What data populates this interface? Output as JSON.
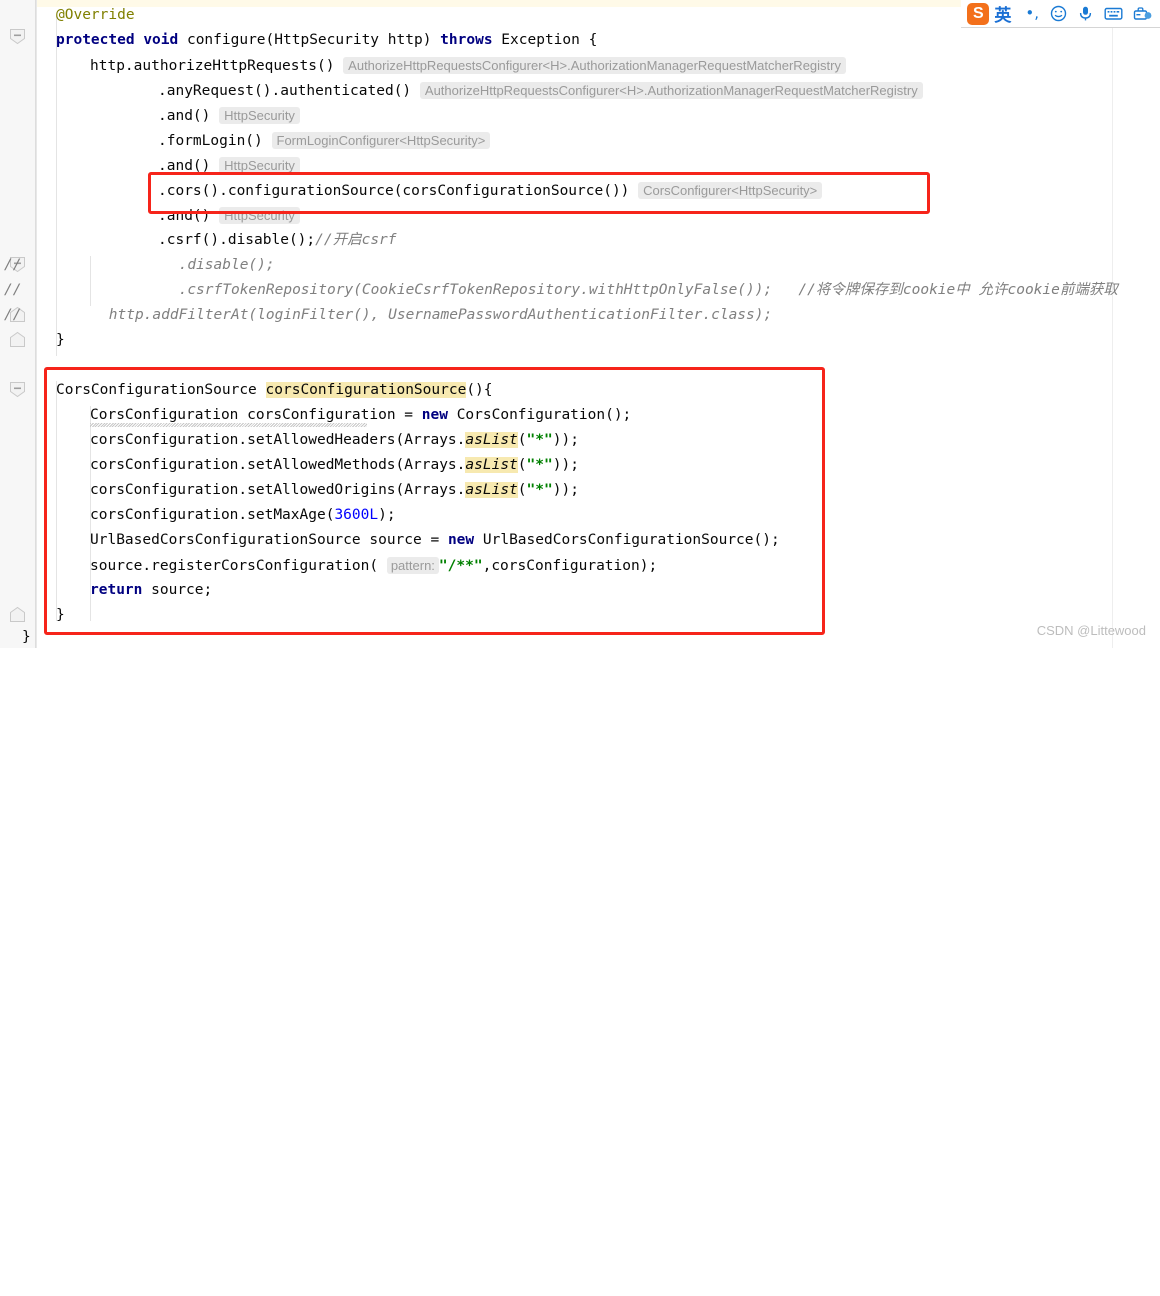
{
  "editor": {
    "caret_line_highlight": "#fffae8",
    "background": "#ffffff",
    "gutter_background": "#f7f7f7",
    "accent_box_color": "#f6241a",
    "identifier_highlight_color": "#f7e9b0",
    "keyword_color": "#000080",
    "string_color": "#008000",
    "comment_color": "#808080",
    "number_color": "#0000ff",
    "inlay_color": "#9a9a9a"
  },
  "code": {
    "lines": [
      {
        "id": "l1",
        "text": "    @Override"
      },
      {
        "id": "l2",
        "text": "    protected void configure(HttpSecurity http) throws Exception {"
      },
      {
        "id": "l3",
        "text": "        http.authorizeHttpRequests()"
      },
      {
        "id": "l3h",
        "text": "AuthorizeHttpRequestsConfigurer<H>.AuthorizationManagerRequestMatcherRegistry"
      },
      {
        "id": "l4",
        "text": "                .anyRequest().authenticated()"
      },
      {
        "id": "l4h",
        "text": "AuthorizeHttpRequestsConfigurer<H>.AuthorizationManagerRequestMatcherRegistry"
      },
      {
        "id": "l5",
        "text": "                .and()"
      },
      {
        "id": "l5h",
        "text": "HttpSecurity"
      },
      {
        "id": "l6",
        "text": "                .formLogin()"
      },
      {
        "id": "l6h",
        "text": "FormLoginConfigurer<HttpSecurity>"
      },
      {
        "id": "l7",
        "text": "                .and()"
      },
      {
        "id": "l7h",
        "text": "HttpSecurity"
      },
      {
        "id": "l8",
        "text": "                .cors().configurationSource(corsConfigurationSource())"
      },
      {
        "id": "l8h",
        "text": "CorsConfigurer<HttpSecurity>"
      },
      {
        "id": "l9",
        "text": "                .and()"
      },
      {
        "id": "l9h",
        "text": "HttpSecurity"
      },
      {
        "id": "l10",
        "text": "                .csrf().disable();"
      },
      {
        "id": "l10c",
        "text": "//开启csrf"
      },
      {
        "id": "l11",
        "text": "//                  .disable();"
      },
      {
        "id": "l12",
        "text": "//                  .csrfTokenRepository(CookieCsrfTokenRepository.withHttpOnlyFalse());   //将令牌保存到cookie中 允许cookie前端获取"
      },
      {
        "id": "l13",
        "text": "//          http.addFilterAt(loginFilter(), UsernamePasswordAuthenticationFilter.class);"
      },
      {
        "id": "l14",
        "text": "    }"
      },
      {
        "id": "l15",
        "text": "    CorsConfigurationSource corsConfigurationSource(){"
      },
      {
        "id": "l16",
        "text": "        CorsConfiguration corsConfiguration = new CorsConfiguration();"
      },
      {
        "id": "l17",
        "text": "        corsConfiguration.setAllowedHeaders(Arrays.asList(\"*\"));"
      },
      {
        "id": "l18",
        "text": "        corsConfiguration.setAllowedMethods(Arrays.asList(\"*\"));"
      },
      {
        "id": "l19",
        "text": "        corsConfiguration.setAllowedOrigins(Arrays.asList(\"*\"));"
      },
      {
        "id": "l20",
        "text": "        corsConfiguration.setMaxAge(3600L);"
      },
      {
        "id": "l21",
        "text": "        UrlBasedCorsConfigurationSource source = new UrlBasedCorsConfigurationSource();"
      },
      {
        "id": "l22",
        "text": "        source.registerCorsConfiguration( \"/**\",corsConfiguration);"
      },
      {
        "id": "l22p",
        "text": "pattern:"
      },
      {
        "id": "l23",
        "text": "        return source;"
      },
      {
        "id": "l24",
        "text": "    }"
      },
      {
        "id": "l25",
        "text": "}"
      }
    ],
    "tokens": {
      "annotation_override": "@Override",
      "kw_protected": "protected",
      "kw_void": "void",
      "kw_throws": "throws",
      "kw_new": "new",
      "kw_return": "return",
      "method_configure": "configure",
      "type_HttpSecurity": "HttpSecurity",
      "param_http": "http",
      "type_Exception": "Exception",
      "call_authorizeHttpRequests": "http.authorizeHttpRequests()",
      "call_anyRequest": ".anyRequest().authenticated()",
      "call_and": ".and()",
      "call_formLogin": ".formLogin()",
      "call_cors": ".cors().configurationSource(corsConfigurationSource())",
      "call_csrf": ".csrf().disable();",
      "comment_csrf": "//开启csrf",
      "comment_disable": "//                  .disable();",
      "comment_tokenrepo": "//                  .csrfTokenRepository(CookieCsrfTokenRepository.withHttpOnlyFalse());",
      "comment_tokenrepo_cn": "//将令牌保存到cookie中 允许cookie前端获取",
      "comment_addfilter": "//          http.addFilterAt(loginFilter(), UsernamePasswordAuthenticationFilter.class);",
      "type_CorsConfigurationSource": "CorsConfigurationSource",
      "method_corsConfigurationSource": "corsConfigurationSource",
      "type_CorsConfiguration": "CorsConfiguration",
      "var_corsConfiguration": "corsConfiguration",
      "static_asList": "asList",
      "class_Arrays": "Arrays",
      "string_star": "\"*\"",
      "number_3600L": "3600L",
      "type_UrlBased": "UrlBasedCorsConfigurationSource",
      "var_source": "source",
      "string_pattern": "\"/**\"",
      "hint_pattern": "pattern:"
    }
  },
  "inlay_hints": [
    {
      "id": "h1",
      "text": "AuthorizeHttpRequestsConfigurer<H>.AuthorizationManagerRequestMatcherRegistry"
    },
    {
      "id": "h2",
      "text": "AuthorizeHttpRequestsConfigurer<H>.AuthorizationManagerRequestMatcherRegistry"
    },
    {
      "id": "h3",
      "text": "HttpSecurity"
    },
    {
      "id": "h4",
      "text": "FormLoginConfigurer<HttpSecurity>"
    },
    {
      "id": "h5",
      "text": "HttpSecurity"
    },
    {
      "id": "h6",
      "text": "CorsConfigurer<HttpSecurity>"
    },
    {
      "id": "h7",
      "text": "HttpSecurity"
    },
    {
      "id": "h8",
      "text": "pattern:"
    }
  ],
  "ime_toolbar": {
    "logo_text": "S",
    "logo_color": "#f3701b",
    "mode_label": "英",
    "icons": [
      {
        "name": "punctuation-icon",
        "glyph": "•,"
      },
      {
        "name": "emoji-icon",
        "glyph": "☺"
      },
      {
        "name": "voice-input-icon",
        "glyph": "🎤"
      },
      {
        "name": "soft-keyboard-icon",
        "glyph": "⌨"
      },
      {
        "name": "toolbox-icon",
        "glyph": "🧰"
      }
    ]
  },
  "watermark": {
    "text": "CSDN @Littewood"
  }
}
